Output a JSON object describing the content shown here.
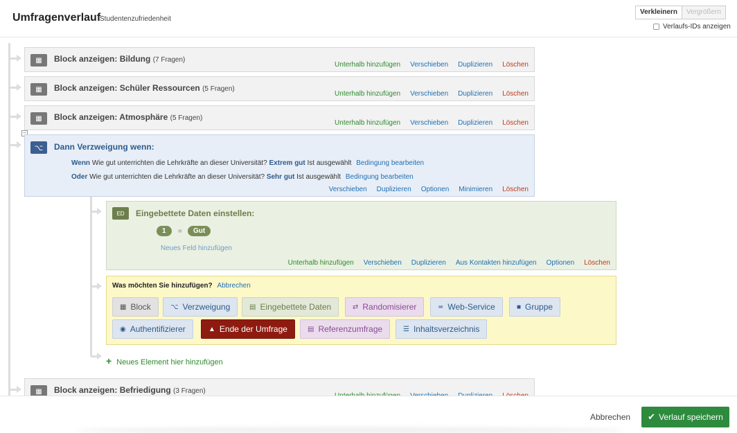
{
  "header": {
    "title": "Umfragenverlauf",
    "subtitle": "Studentenzufriedenheit",
    "zoom_out": "Verkleinern",
    "zoom_in": "Vergrößern",
    "show_ids": "Verlaufs-IDs anzeigen"
  },
  "block_actions": {
    "add_below": "Unterhalb hinzufügen",
    "move": "Verschieben",
    "duplicate": "Duplizieren",
    "delete": "Löschen"
  },
  "blocks": [
    {
      "title": "Block anzeigen: Bildung",
      "count": "(7 Fragen)"
    },
    {
      "title": "Block anzeigen: Schüler Ressourcen",
      "count": "(5 Fragen)"
    },
    {
      "title": "Block anzeigen: Atmosphäre",
      "count": "(5 Fragen)"
    },
    {
      "title": "Block anzeigen: Befriedigung",
      "count": "(3 Fragen)"
    }
  ],
  "branch": {
    "title": "Dann Verzweigung wenn:",
    "conditions": [
      {
        "conj": "Wenn",
        "question": "Wie gut unterrichten die Lehrkräfte an dieser Universität?",
        "answer": "Extrem gut",
        "state": "Ist ausgewählt",
        "edit": "Bedingung bearbeiten"
      },
      {
        "conj": "Oder",
        "question": "Wie gut unterrichten die Lehrkräfte an dieser Universität?",
        "answer": "Sehr gut",
        "state": "Ist ausgewählt",
        "edit": "Bedingung bearbeiten"
      }
    ],
    "actions": {
      "move": "Verschieben",
      "duplicate": "Duplizieren",
      "options": "Optionen",
      "minimize": "Minimieren",
      "delete": "Löschen"
    }
  },
  "embedded": {
    "title": "Eingebettete Daten einstellen:",
    "field_name": "1",
    "equals": "=",
    "field_value": "Gut",
    "add_field": "Neues Feld hinzufügen",
    "actions": {
      "add_below": "Unterhalb hinzufügen",
      "move": "Verschieben",
      "duplicate": "Duplizieren",
      "from_contacts": "Aus Kontakten hinzufügen",
      "options": "Optionen",
      "delete": "Löschen"
    }
  },
  "add_panel": {
    "question": "Was möchten Sie hinzufügen?",
    "cancel": "Abbrechen",
    "options": {
      "block": "Block",
      "branch": "Verzweigung",
      "embedded": "Eingebettete Daten",
      "randomizer": "Randomisierer",
      "web_service": "Web-Service",
      "group": "Gruppe",
      "authenticator": "Authentifizierer",
      "end_of_survey": "Ende der Umfrage",
      "reference_survey": "Referenzumfrage",
      "table_of_contents": "Inhaltsverzeichnis"
    }
  },
  "new_element": "Neues Element hier hinzufügen",
  "footer": {
    "cancel": "Abbrechen",
    "save": "Verlauf speichern"
  },
  "colors": {
    "accent_green": "#2e8b3e",
    "link_blue": "#1f6fb2",
    "delete_red": "#c03a1a",
    "end_survey": "#8e1b10"
  }
}
